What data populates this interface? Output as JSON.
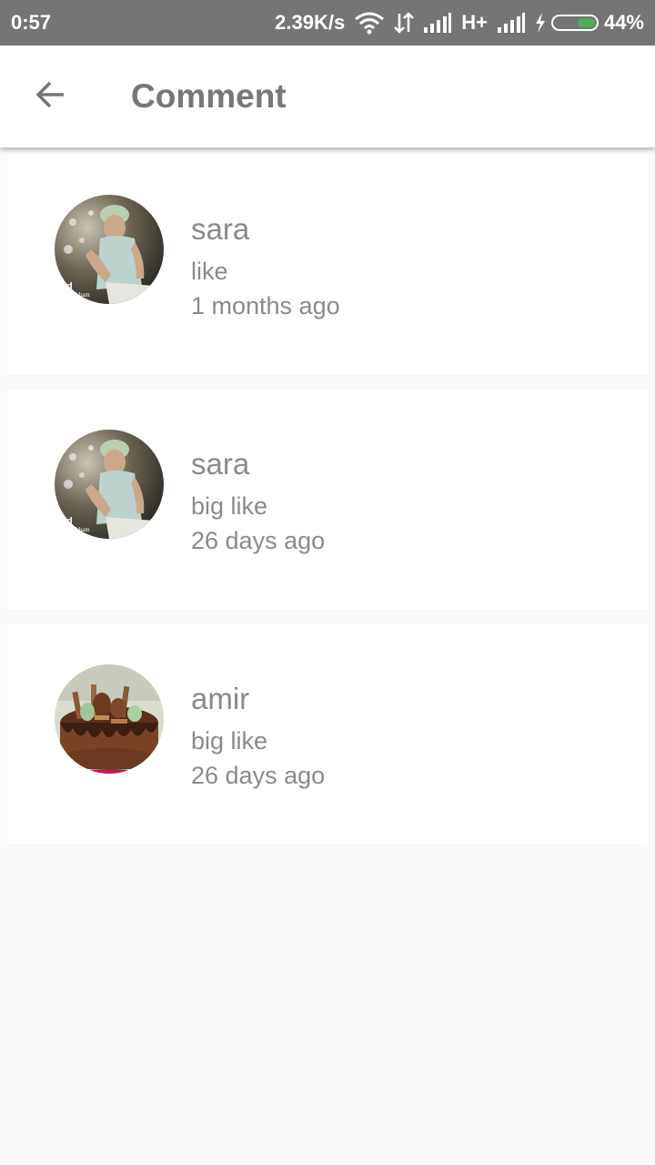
{
  "status_bar": {
    "time": "0:57",
    "network_speed": "2.39K/s",
    "network_type": "H+",
    "battery_percent": "44%",
    "battery_level": 0.44,
    "battery_color": "#4caf50"
  },
  "app_bar": {
    "title": "Comment",
    "back_icon": "arrow-left-icon"
  },
  "comments": [
    {
      "user": "sara",
      "text": "like",
      "time": "1 months ago",
      "avatar": "person-photo"
    },
    {
      "user": "sara",
      "text": "big like",
      "time": "26 days ago",
      "avatar": "person-photo"
    },
    {
      "user": "amir",
      "text": "big like",
      "time": "26 days ago",
      "avatar": "cake-photo"
    }
  ]
}
